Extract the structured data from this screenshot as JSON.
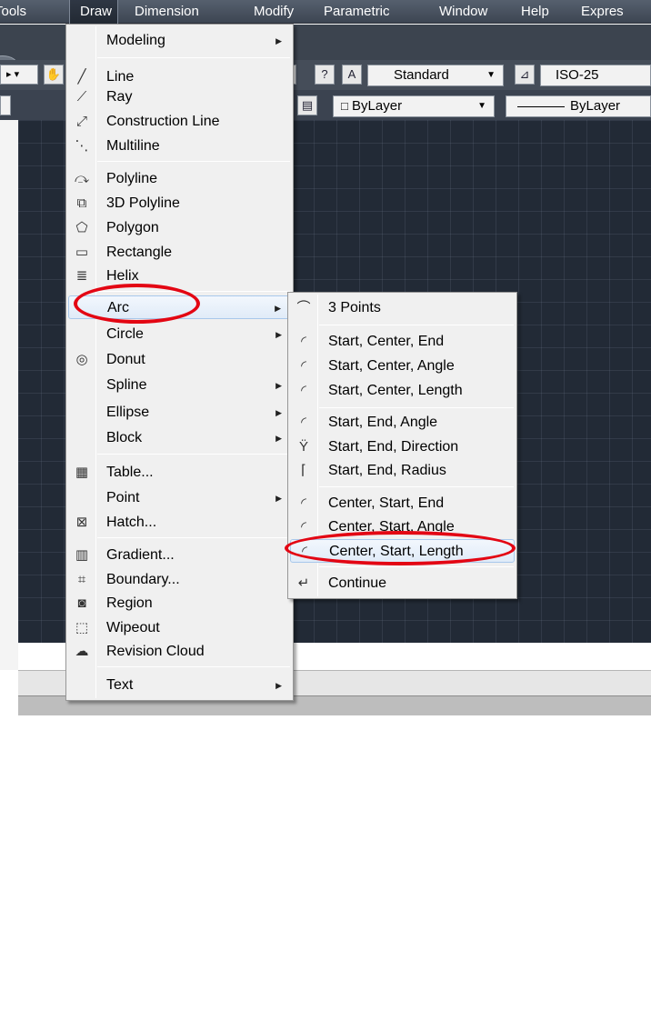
{
  "colors": {
    "accent_highlight": "#dbe8f7",
    "annotation": "#e30613",
    "menubar": "#4a525e",
    "canvas": "#222a36"
  },
  "menubar": [
    {
      "label": "Tools"
    },
    {
      "label": "Draw"
    },
    {
      "label": "Dimension"
    },
    {
      "label": "Modify"
    },
    {
      "label": "Parametric"
    },
    {
      "label": "Window"
    },
    {
      "label": "Help"
    },
    {
      "label": "Expres"
    }
  ],
  "toolbar": {
    "text_style": "Standard",
    "dim_style": "ISO-25",
    "color_control": "ByLayer",
    "linetype_control": "ByLayer"
  },
  "draw_menu": {
    "items": [
      {
        "label": "Modeling",
        "icon": "",
        "submenu": true
      },
      {
        "label": "Line",
        "icon": "line-icon",
        "submenu": false
      },
      {
        "label": "Ray",
        "icon": "ray-icon",
        "submenu": false
      },
      {
        "label": "Construction Line",
        "icon": "construction-line-icon",
        "submenu": false
      },
      {
        "label": "Multiline",
        "icon": "multiline-icon",
        "submenu": false
      },
      {
        "label": "Polyline",
        "icon": "polyline-icon",
        "submenu": false
      },
      {
        "label": "3D Polyline",
        "icon": "3d-polyline-icon",
        "submenu": false
      },
      {
        "label": "Polygon",
        "icon": "polygon-icon",
        "submenu": false
      },
      {
        "label": "Rectangle",
        "icon": "rectangle-icon",
        "submenu": false
      },
      {
        "label": "Helix",
        "icon": "helix-icon",
        "submenu": false
      },
      {
        "label": "Arc",
        "icon": "",
        "submenu": true
      },
      {
        "label": "Circle",
        "icon": "",
        "submenu": true
      },
      {
        "label": "Donut",
        "icon": "donut-icon",
        "submenu": false
      },
      {
        "label": "Spline",
        "icon": "",
        "submenu": true
      },
      {
        "label": "Ellipse",
        "icon": "",
        "submenu": true
      },
      {
        "label": "Block",
        "icon": "",
        "submenu": true
      },
      {
        "label": "Table...",
        "icon": "table-icon",
        "submenu": false
      },
      {
        "label": "Point",
        "icon": "",
        "submenu": true
      },
      {
        "label": "Hatch...",
        "icon": "hatch-icon",
        "submenu": false
      },
      {
        "label": "Gradient...",
        "icon": "gradient-icon",
        "submenu": false
      },
      {
        "label": "Boundary...",
        "icon": "boundary-icon",
        "submenu": false
      },
      {
        "label": "Region",
        "icon": "region-icon",
        "submenu": false
      },
      {
        "label": "Wipeout",
        "icon": "wipeout-icon",
        "submenu": false
      },
      {
        "label": "Revision Cloud",
        "icon": "revision-cloud-icon",
        "submenu": false
      },
      {
        "label": "Text",
        "icon": "",
        "submenu": true
      }
    ]
  },
  "arc_submenu": {
    "items": [
      {
        "label": "3 Points",
        "icon": "arc-3-points-icon"
      },
      {
        "label": "Start, Center, End",
        "icon": "arc-start-center-end-icon"
      },
      {
        "label": "Start, Center, Angle",
        "icon": "arc-start-center-angle-icon"
      },
      {
        "label": "Start, Center, Length",
        "icon": "arc-start-center-length-icon"
      },
      {
        "label": "Start, End, Angle",
        "icon": "arc-start-end-angle-icon"
      },
      {
        "label": "Start, End, Direction",
        "icon": "arc-start-end-direction-icon"
      },
      {
        "label": "Start, End, Radius",
        "icon": "arc-start-end-radius-icon"
      },
      {
        "label": "Center, Start, End",
        "icon": "arc-center-start-end-icon"
      },
      {
        "label": "Center, Start, Angle",
        "icon": "arc-center-start-angle-icon"
      },
      {
        "label": "Center, Start, Length",
        "icon": "arc-center-start-length-icon"
      },
      {
        "label": "Continue",
        "icon": "arc-continue-icon"
      }
    ]
  }
}
